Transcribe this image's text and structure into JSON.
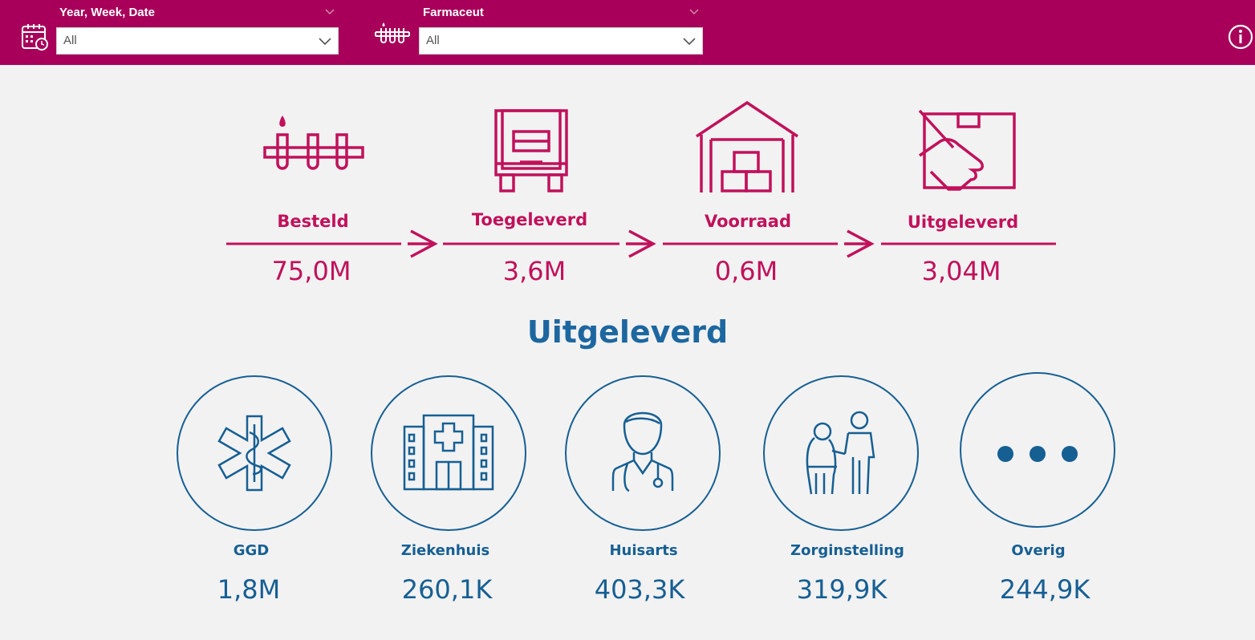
{
  "filters": {
    "date": {
      "label": "Year, Week, Date",
      "value": "All",
      "icon": "calendar-clock-icon"
    },
    "pharma": {
      "label": "Farmaceut",
      "value": "All",
      "icon": "vial-rack-icon"
    }
  },
  "header": {
    "info_icon": "info-icon"
  },
  "colors": {
    "brand": "#a8005a",
    "funnel": "#c1115b",
    "category": "#165f93",
    "background": "#f2f2f2"
  },
  "funnel": [
    {
      "label": "Besteld",
      "value": "75,0M",
      "icon": "vial-rack-icon"
    },
    {
      "label": "Toegeleverd",
      "value": "3,6M",
      "icon": "truck-icon"
    },
    {
      "label": "Voorraad",
      "value": "0,6M",
      "icon": "warehouse-icon"
    },
    {
      "label": "Uitgeleverd",
      "value": "3,04M",
      "icon": "hand-package-icon"
    }
  ],
  "section_title": "Uitgeleverd",
  "categories": [
    {
      "label": "GGD",
      "value": "1,8M",
      "icon": "star-of-life-icon"
    },
    {
      "label": "Ziekenhuis",
      "value": "260,1K",
      "icon": "hospital-icon"
    },
    {
      "label": "Huisarts",
      "value": "403,3K",
      "icon": "doctor-icon"
    },
    {
      "label": "Zorginstelling",
      "value": "319,9K",
      "icon": "elderly-care-icon"
    },
    {
      "label": "Overig",
      "value": "244,9K",
      "icon": "more-dots-icon"
    }
  ]
}
